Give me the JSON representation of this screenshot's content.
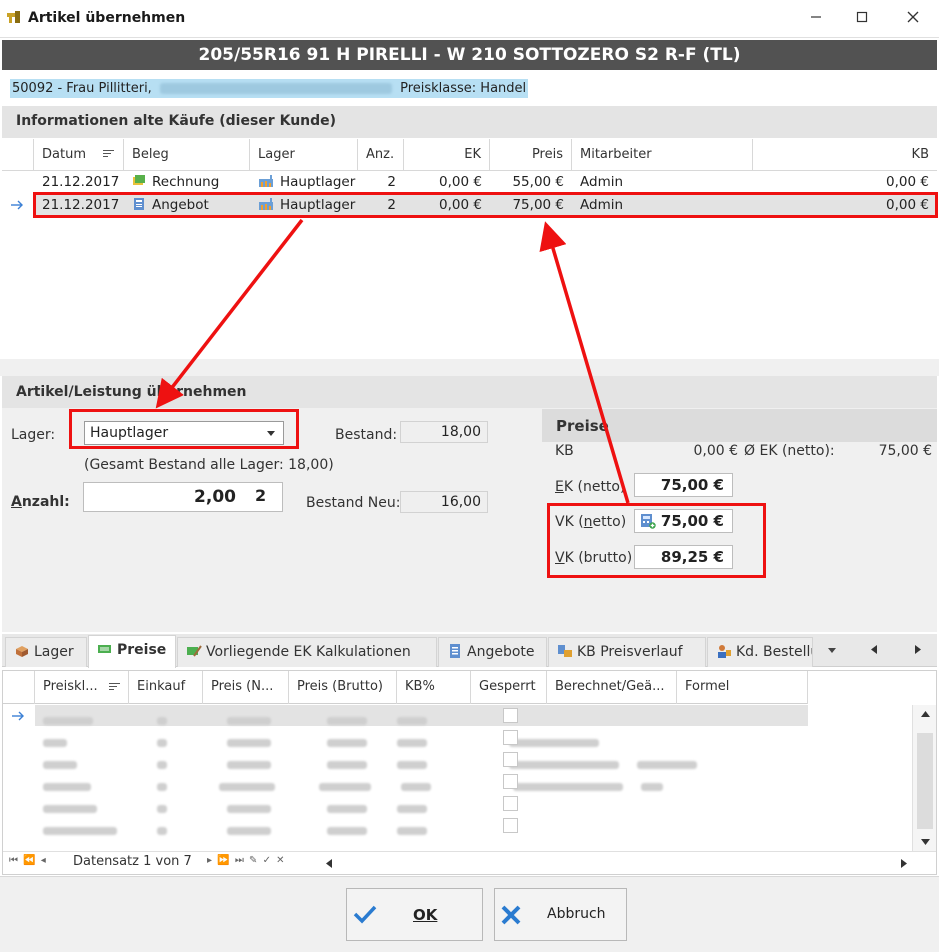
{
  "window": {
    "title": "Artikel übernehmen"
  },
  "header": {
    "article": "205/55R16 91 H PIRELLI - W 210 SOTTOZERO S2 R-F (TL)"
  },
  "customer": {
    "prefix": "50092 - Frau Pillitteri,",
    "suffix": "Preisklasse: Handel"
  },
  "purchases": {
    "section_title": "Informationen alte Käufe (dieser Kunde)",
    "columns": [
      "Datum",
      "Beleg",
      "Lager",
      "Anz.",
      "EK",
      "Preis",
      "Mitarbeiter",
      "KB"
    ],
    "rows": [
      {
        "datum": "21.12.2017",
        "beleg": "Rechnung",
        "lager": "Hauptlager",
        "anz": "2",
        "ek": "0,00 €",
        "preis": "55,00 €",
        "mitarbeiter": "Admin",
        "kb": "0,00 €"
      },
      {
        "datum": "21.12.2017",
        "beleg": "Angebot",
        "lager": "Hauptlager",
        "anz": "2",
        "ek": "0,00 €",
        "preis": "75,00 €",
        "mitarbeiter": "Admin",
        "kb": "0,00 €"
      }
    ],
    "selected_row": 1
  },
  "take_over": {
    "section_title": "Artikel/Leistung übernehmen",
    "lager_label": "Lager:",
    "lager_value": "Hauptlager",
    "gesamt_bestand": "(Gesamt Bestand alle Lager: 18,00)",
    "bestand_label": "Bestand:",
    "bestand_value": "18,00",
    "anzahl_label": "Anzahl:",
    "anzahl_value": "2,00",
    "anzahl_typed": "2",
    "bestand_neu_label": "Bestand Neu:",
    "bestand_neu_value": "16,00"
  },
  "prices": {
    "section_title": "Preise",
    "kb_label": "KB",
    "kb_value": "0,00 €",
    "avg_ek_label": "Ø EK (netto):",
    "avg_ek_value": "75,00 €",
    "ek_label": "EK (netto)",
    "ek_value": "75,00 €",
    "vk_netto_label": "VK (netto)",
    "vk_netto_value": "75,00 €",
    "vk_brutto_label": "VK (brutto)",
    "vk_brutto_value": "89,25 €"
  },
  "tabs": [
    "Lager",
    "Preise",
    "Vorliegende EK Kalkulationen",
    "Angebote",
    "KB Preisverlauf",
    "Kd. Bestellu"
  ],
  "active_tab": "Preise",
  "price_grid": {
    "columns": [
      "Preiskl...",
      "Einkauf",
      "Preis (N...",
      "Preis (Brutto)",
      "KB%",
      "Gesperrt",
      "Berechnet/Geä...",
      "Formel"
    ],
    "navigator": "Datensatz 1 von 7"
  },
  "buttons": {
    "ok": "OK",
    "cancel": "Abbruch"
  },
  "colors": {
    "header_bg": "#525252",
    "highlight": "#ee1111",
    "customer_bg": "#b7dff3"
  }
}
